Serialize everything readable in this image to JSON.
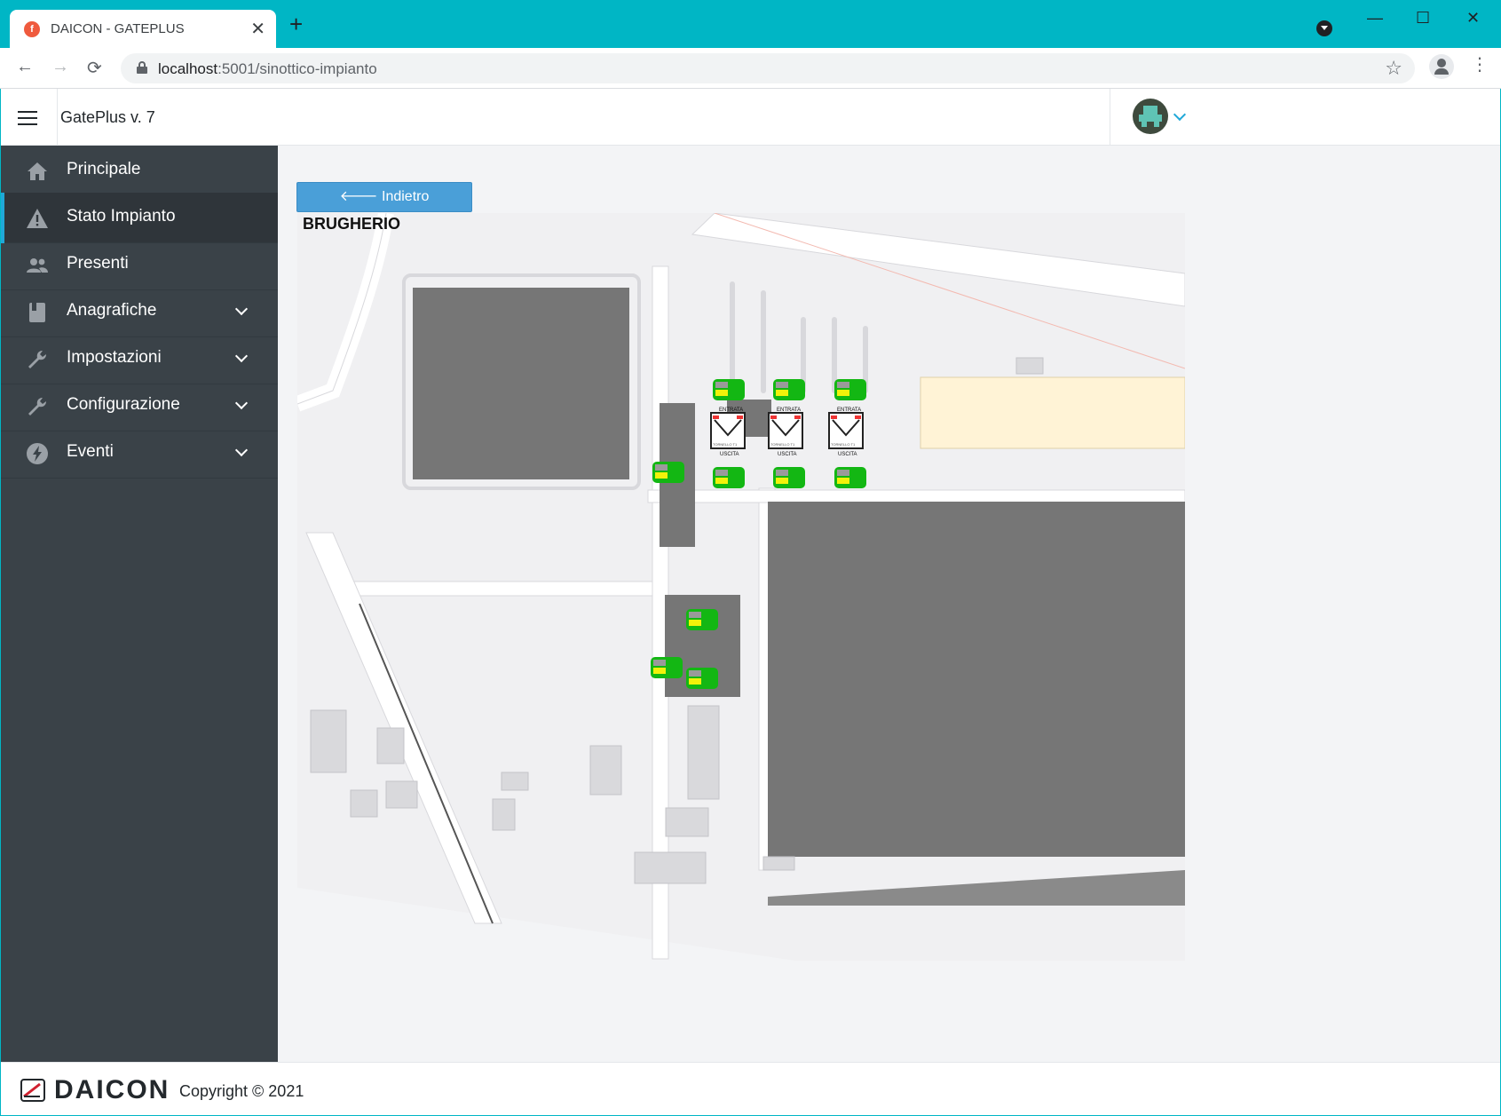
{
  "browser": {
    "tab_title": "DAICON - GATEPLUS",
    "tab_close": "✕",
    "new_tab": "+",
    "favicon_letter": "f",
    "url_host": "localhost",
    "url_path": ":5001/sinottico-impianto",
    "back": "←",
    "forward": "→",
    "reload": "⟳",
    "star": "☆",
    "menu": "⋮",
    "win_min": "—",
    "win_max": "☐",
    "win_close": "✕"
  },
  "header": {
    "app_title": "GatePlus v. 7"
  },
  "sidebar": {
    "items": [
      {
        "label": "Principale",
        "icon": "home-icon"
      },
      {
        "label": "Stato Impianto",
        "icon": "warning-icon"
      },
      {
        "label": "Presenti",
        "icon": "people-icon"
      },
      {
        "label": "Anagrafiche",
        "icon": "book-icon"
      },
      {
        "label": "Impostazioni",
        "icon": "wrench-icon"
      },
      {
        "label": "Configurazione",
        "icon": "wrench-icon"
      },
      {
        "label": "Eventi",
        "icon": "bolt-icon"
      }
    ]
  },
  "main": {
    "back_button": "🡐 Indietro",
    "site_name": "BRUGHERIO",
    "turnstile_top_label": "ENTRATA",
    "turnstile_bottom_label": "USCITA",
    "turnstile_caption": "TORNELLO T1",
    "device_status_color": "#13b713",
    "device_indicator_color": "#f2f20a"
  },
  "footer": {
    "brand": "DAICON",
    "copyright": "Copyright © 2021"
  }
}
